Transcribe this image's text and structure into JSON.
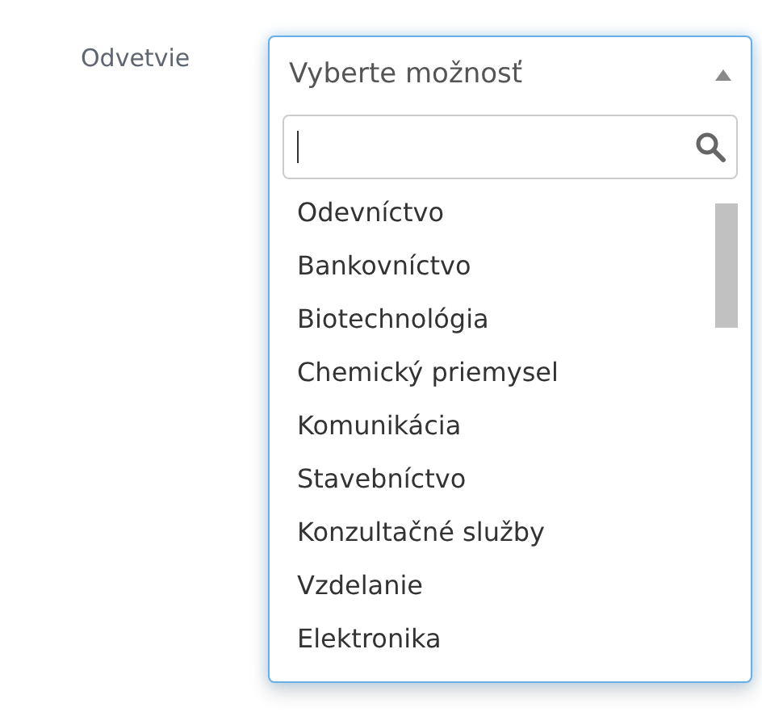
{
  "field": {
    "label": "Odvetvie",
    "select": {
      "placeholder": "Vyberte možnosť",
      "expanded": true
    }
  },
  "dropdown": {
    "options": [
      {
        "label": "Odevníctvo",
        "selected": false
      },
      {
        "label": "Bankovníctvo",
        "selected": false
      },
      {
        "label": "Biotechnológia",
        "selected": false
      },
      {
        "label": "Chemický priemysel",
        "selected": false
      },
      {
        "label": "Komunikácia",
        "selected": false
      },
      {
        "label": "Stavebníctvo",
        "selected": false
      },
      {
        "label": "Konzultačné služby",
        "selected": false
      },
      {
        "label": "Vzdelanie",
        "selected": false
      },
      {
        "label": "Elektronika",
        "selected": false
      }
    ]
  }
}
